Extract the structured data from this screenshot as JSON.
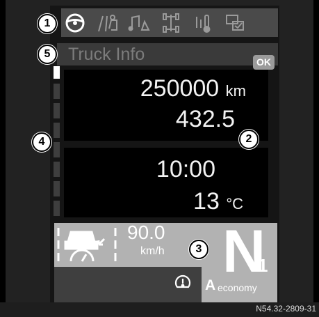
{
  "icon_bar": {
    "tabs": [
      {
        "icon": "steering-wheel-icon",
        "selected": true
      },
      {
        "icon": "lane-assist-icon",
        "selected": false
      },
      {
        "icon": "audio-phone-icon",
        "selected": false
      },
      {
        "icon": "axle-configuration-icon",
        "selected": false
      },
      {
        "icon": "hydraulic-temperature-icon",
        "selected": false
      },
      {
        "icon": "settings-check-icon",
        "selected": false
      }
    ]
  },
  "menu": {
    "title": "Truck Info",
    "ok_label": "OK"
  },
  "odometer": {
    "value": "250000",
    "unit": "km"
  },
  "trip": {
    "value": "432.5"
  },
  "clock": {
    "time": "10:00"
  },
  "temperature": {
    "value": "13",
    "unit": "°C"
  },
  "status_bar": {
    "speed_value": "90.0",
    "speed_unit": "km/h",
    "gear": "N",
    "gear_sub": "1",
    "mode_letter": "A",
    "mode_label": "economy",
    "cruise_icon": "cruise-control-icon",
    "warning_icon": "tire-pressure-warning-icon"
  },
  "callouts": [
    "1",
    "2",
    "3",
    "4",
    "5"
  ],
  "figure_code": "N54.32-2809-31",
  "colors": {
    "background": "#000000",
    "panel": "#151515",
    "icon_bar": "#4a4a4a",
    "status_bar": "#b2b2b2"
  }
}
